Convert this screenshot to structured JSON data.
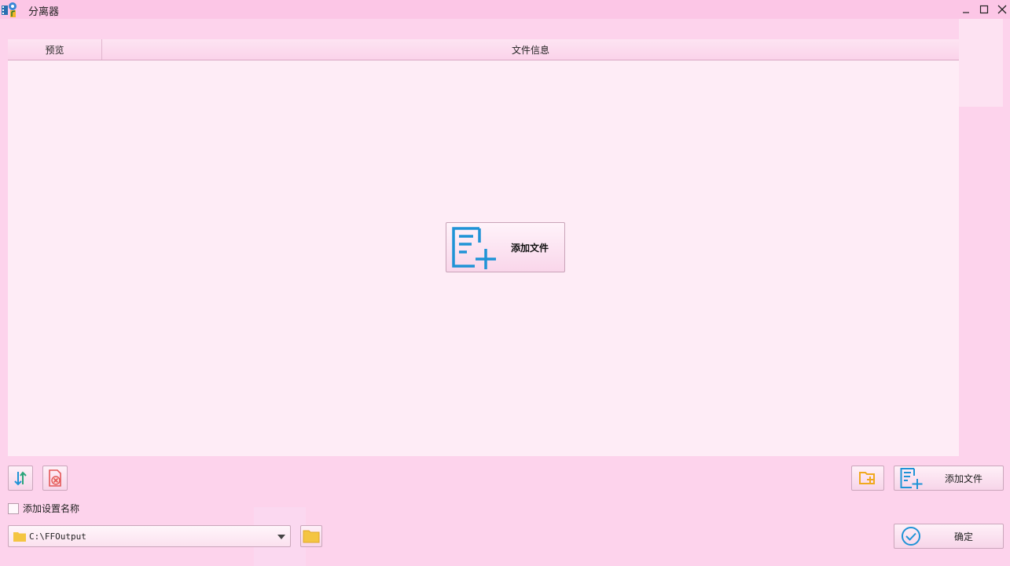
{
  "window": {
    "title": "分离器"
  },
  "table": {
    "columns": [
      "预览",
      "文件信息"
    ]
  },
  "center": {
    "add_file_label": "添加文件"
  },
  "toolbar": {
    "add_file_label": "添加文件",
    "confirm_label": "确定"
  },
  "options": {
    "add_setting_name_label": "添加设置名称",
    "add_setting_name_checked": false
  },
  "output": {
    "path": "C:\\FFOutput"
  },
  "icons": {
    "app": "app-icon",
    "add_file": "add-file-icon",
    "sort": "sort-icon",
    "delete": "delete-icon",
    "add_folder": "add-folder-icon",
    "folder": "folder-icon",
    "check": "check-circle-icon"
  },
  "colors": {
    "accent_blue": "#1f93d6",
    "delete_red": "#e45757",
    "folder_yellow": "#f4c542"
  }
}
